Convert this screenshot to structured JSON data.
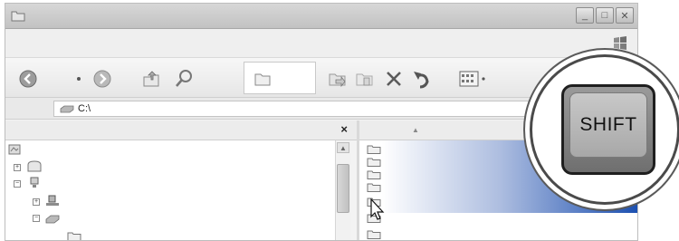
{
  "window": {
    "buttons": {
      "minimize": "_",
      "maximize": "□",
      "close": "✕"
    }
  },
  "toolbar": {
    "icons": [
      "back-icon",
      "dropdown-icon",
      "forward-icon",
      "up-folder-icon",
      "search-icon",
      "folders-icon",
      "move-to-icon",
      "copy-to-icon",
      "delete-icon",
      "undo-icon",
      "views-icon"
    ]
  },
  "address": {
    "value": "C:\\"
  },
  "left_pane": {
    "close_label": "×"
  },
  "right_pane": {
    "sort_indicator": "▲"
  },
  "callout": {
    "key_label": "SHIFT"
  },
  "colors": {
    "selection": "#1b4fb0",
    "selection_light": "#aebee0"
  }
}
